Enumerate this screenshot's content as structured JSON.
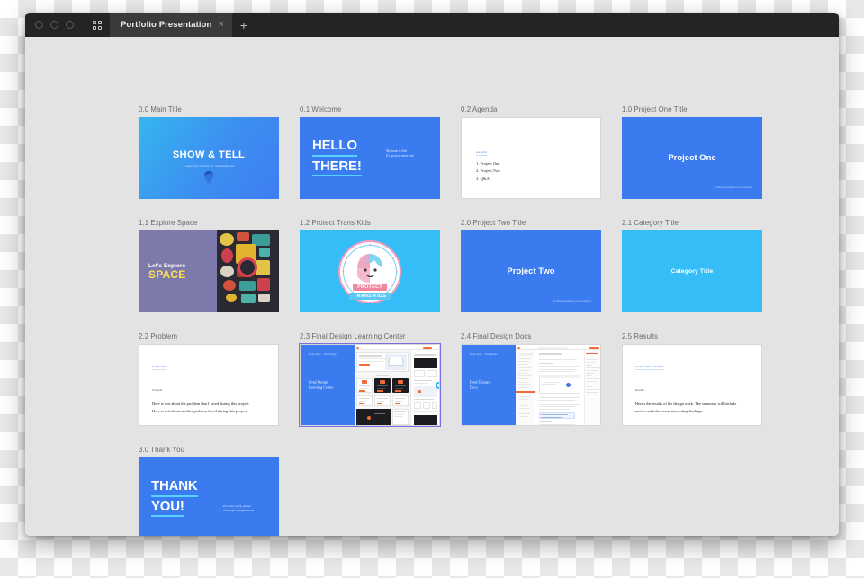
{
  "window": {
    "traffic_lights": [
      "close",
      "minimize",
      "maximize"
    ],
    "grid_view_icon": "grid-icon",
    "tab": {
      "label": "Portfolio Presentation",
      "close_label": "×"
    },
    "new_tab_label": "+"
  },
  "slides": [
    {
      "caption": "0.0 Main Title",
      "kind": "show-tell",
      "title": "SHOW & TELL",
      "subtitle": "a selection of work by ash kirkhouse",
      "bg": "#35b6f0"
    },
    {
      "caption": "0.1 Welcome",
      "kind": "hello",
      "line1": "HELLO",
      "line2": "THERE!",
      "note": "My name is Ash.\nIt's great to meet you!",
      "bg": "#3a7bf0"
    },
    {
      "caption": "0.2 Agenda",
      "kind": "agenda",
      "kicker": "Agenda",
      "items": [
        "1. Project One",
        "2. Project Two",
        "3. Q&A"
      ],
      "bg": "#ffffff"
    },
    {
      "caption": "1.0 Project One Title",
      "kind": "project",
      "title": "Project One",
      "footnote": "Possible explanation or title summary",
      "bg": "#3a7bf0"
    },
    {
      "caption": "1.1 Explore Space",
      "kind": "space",
      "line1": "Let's Explore",
      "line2": "SPACE",
      "bg": "#7e79ab"
    },
    {
      "caption": "1.2 Protect Trans Kids",
      "kind": "protect",
      "tag1": "PROTECT",
      "tag2": "TRANS KIDS",
      "bg": "#35bdf7"
    },
    {
      "caption": "2.0 Project Two Title",
      "kind": "project",
      "title": "Project Two",
      "footnote": "Possible explanation or title summary",
      "bg": "#3a7bf0"
    },
    {
      "caption": "2.1 Category Title",
      "kind": "category",
      "title": "Category Title",
      "bg": "#35bdf7"
    },
    {
      "caption": "2.2 Problem",
      "kind": "textbody",
      "kicker": "Project One",
      "heading": "Problem",
      "body": "Here is text about the problem that I faced during this project. Here is text about another problem faced during this project",
      "bg": "#ffffff"
    },
    {
      "caption": "2.3 Final Design Learning Center",
      "kind": "design",
      "kicker": "Project One — Final Design",
      "title": "Final Design\nLearning Center",
      "selected": true,
      "bg": "#3a7bf0"
    },
    {
      "caption": "2.4 Final Design Docs",
      "kind": "design",
      "kicker": "Project One — Final Design",
      "title": "Final Design -\nDocs",
      "selected": false,
      "bg": "#3a7bf0"
    },
    {
      "caption": "2.5 Results",
      "kind": "textbody",
      "kicker": "Project One — Results",
      "heading": "Results",
      "body": "Here's the results of the design work. The summary will include metrics and also some interesting findings.",
      "bg": "#ffffff"
    },
    {
      "caption": "3.0 Thank You",
      "kind": "thanks",
      "line1": "THANK",
      "line2": "YOU!",
      "note": "For more work, please\nvisit https://ashgallen.me",
      "bg": "#3a7bf0"
    }
  ]
}
